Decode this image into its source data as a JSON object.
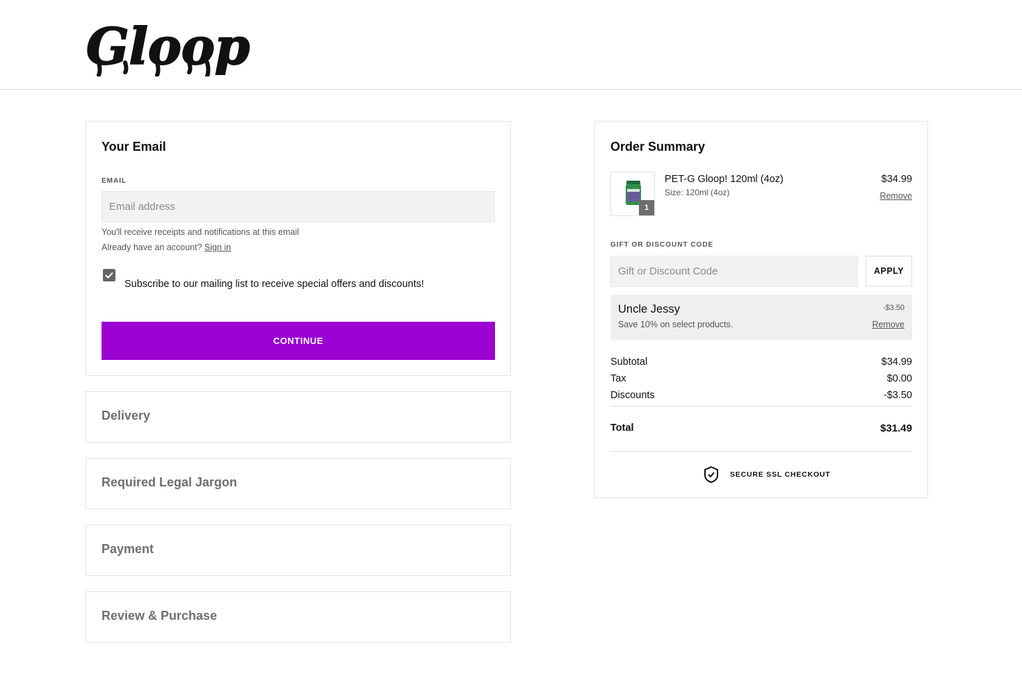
{
  "brand": {
    "logo_text": "Gloop!"
  },
  "email_section": {
    "title": "Your Email",
    "email_label": "EMAIL",
    "email_placeholder": "Email address",
    "email_value": "",
    "receipt_note": "You'll receive receipts and notifications at this email",
    "account_prompt": "Already have an account?",
    "sign_in_label": "Sign in",
    "subscribe_label": "Subscribe to our mailing list to receive special offers and discounts!",
    "subscribe_checked": true,
    "continue_label": "CONTINUE"
  },
  "steps": [
    {
      "label": "Delivery"
    },
    {
      "label": "Required Legal Jargon"
    },
    {
      "label": "Payment"
    },
    {
      "label": "Review & Purchase"
    }
  ],
  "order_summary": {
    "title": "Order Summary",
    "item": {
      "name": "PET-G Gloop! 120ml (4oz)",
      "variant": "Size: 120ml (4oz)",
      "price": "$34.99",
      "quantity": "1",
      "remove_label": "Remove"
    },
    "discount_code_label": "GIFT OR DISCOUNT CODE",
    "discount_code_placeholder": "Gift or Discount Code",
    "apply_label": "APPLY",
    "applied_discount": {
      "name": "Uncle Jessy",
      "description": "Save 10% on select products.",
      "amount": "-$3.50",
      "remove_label": "Remove"
    },
    "totals": {
      "subtotal_label": "Subtotal",
      "subtotal_value": "$34.99",
      "tax_label": "Tax",
      "tax_value": "$0.00",
      "discounts_label": "Discounts",
      "discounts_value": "-$3.50",
      "total_label": "Total",
      "total_value": "$31.49"
    },
    "secure_label": "SECURE SSL CHECKOUT"
  },
  "colors": {
    "accent": "#9a00d2",
    "checkbox": "#666666"
  },
  "icons": {
    "shield": "shield-check-icon",
    "checkbox": "check-icon"
  }
}
